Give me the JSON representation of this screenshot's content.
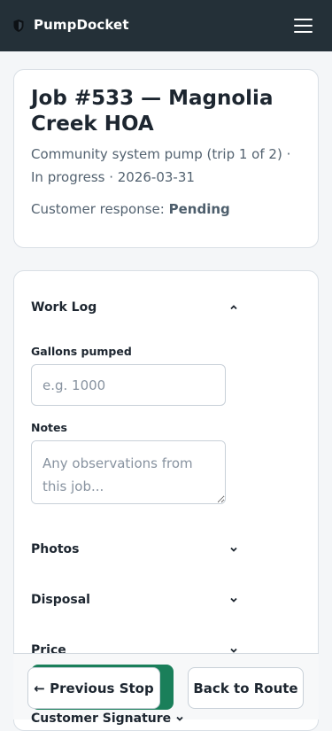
{
  "header": {
    "brand": "PumpDocket",
    "brand_icon": "shield-icon",
    "menu_icon": "hamburger-menu-icon",
    "background": "#243038"
  },
  "job": {
    "title": "Job #533 — Magnolia Creek HOA",
    "meta": "Community system pump (trip 1 of 2) · In progress · 2026-03-31",
    "response_label": "Customer response:",
    "response_value": "Pending"
  },
  "work_log": {
    "title": "Work Log",
    "expanded": true,
    "gallons": {
      "label": "Gallons pumped",
      "value": "",
      "placeholder": "e.g. 1000"
    },
    "notes": {
      "label": "Notes",
      "value": "",
      "placeholder": "Any observations from this job..."
    }
  },
  "sections": [
    {
      "label": "Photos"
    },
    {
      "label": "Disposal"
    },
    {
      "label": "Price"
    },
    {
      "label": "Customer Signature"
    }
  ],
  "actions": {
    "previous_stop": "← Previous Stop",
    "back_to_route": "Back to Route",
    "accent": "#1a7f5a"
  }
}
